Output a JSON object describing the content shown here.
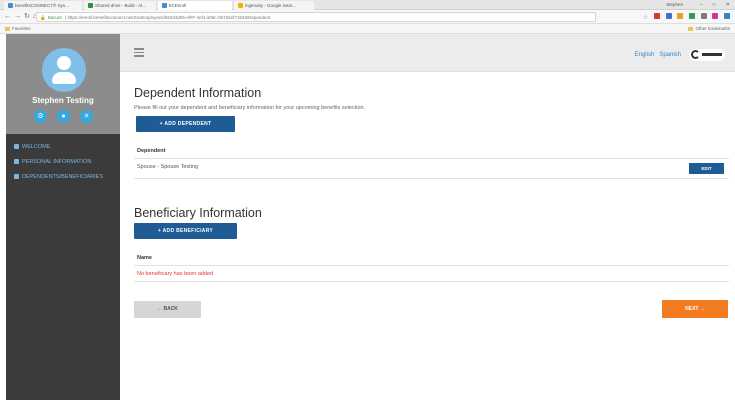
{
  "browser": {
    "tabs": [
      "benefitsCONNECT® Sys...",
      "Shared drive - Build - Al...",
      "bCEnroll",
      "ingenuity - Google Sear..."
    ],
    "profile_label": "Stephen",
    "url_secure": "Secure",
    "url": "https://enroll.benefitsconnect.net/SsoEmployees/b5334d06-ef97-4ef1-a08c-0b7d2ef71533/Dependent",
    "bookmarks_left": "Favorites",
    "bookmarks_right": "Other bookmarks"
  },
  "sidebar": {
    "user_name": "Stephen Testing",
    "items": [
      {
        "label": "WELCOME"
      },
      {
        "label": "PERSONAL INFORMATION"
      },
      {
        "label": "DEPENDENTS/BENEFICIARIES"
      }
    ]
  },
  "topbar": {
    "lang_english": "English",
    "lang_spanish": "Spanish"
  },
  "dependents": {
    "title": "Dependent Information",
    "subtitle": "Please fill out your dependent and beneficiary information for your upcoming benefits selection.",
    "add_button": "+ ADD DEPENDENT",
    "column_header": "Dependent",
    "rows": [
      {
        "name": "Spouse - Spouse Testing",
        "action": "EDIT"
      }
    ]
  },
  "beneficiaries": {
    "title": "Beneficiary Information",
    "add_button": "+ ADD BENEFICIARY",
    "column_header": "Name",
    "empty_message": "No beneficiary has been added"
  },
  "footer": {
    "back_label": "← BACK",
    "next_label": "NEXT →"
  },
  "colors": {
    "primary_button": "#1f5c95",
    "next_button": "#f37b20",
    "sidebar_bg": "#3b3b3b",
    "error_text": "#e0352b"
  }
}
